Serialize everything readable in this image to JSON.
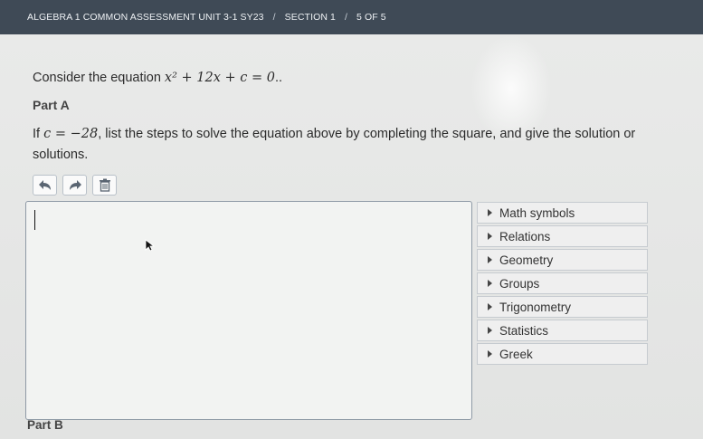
{
  "breadcrumb": {
    "assessment": "ALGEBRA 1 COMMON ASSESSMENT UNIT 3-1 SY23",
    "section": "SECTION 1",
    "progress": "5 OF 5",
    "separator": "/"
  },
  "question": {
    "intro": "Consider the equation ",
    "equation": "x² + 12x + c = 0",
    "end": ".."
  },
  "part_a": {
    "label": "Part A",
    "prompt_prefix": "If ",
    "condition": "c = −28",
    "prompt_suffix": ", list the steps to solve the equation above by completing the square, and give the solution or solutions."
  },
  "toolbar": {
    "undo_icon": "undo-icon",
    "redo_icon": "redo-icon",
    "delete_icon": "trash-icon"
  },
  "answer": {
    "value": ""
  },
  "math_panel": {
    "items": [
      "Math symbols",
      "Relations",
      "Geometry",
      "Groups",
      "Trigonometry",
      "Statistics",
      "Greek"
    ]
  },
  "part_b": {
    "label": "Part B"
  },
  "colors": {
    "topbar": "#3f4a56",
    "page_bg": "#e6e7e6",
    "text": "#2b2b2b",
    "box_border": "#8f9aa6"
  }
}
